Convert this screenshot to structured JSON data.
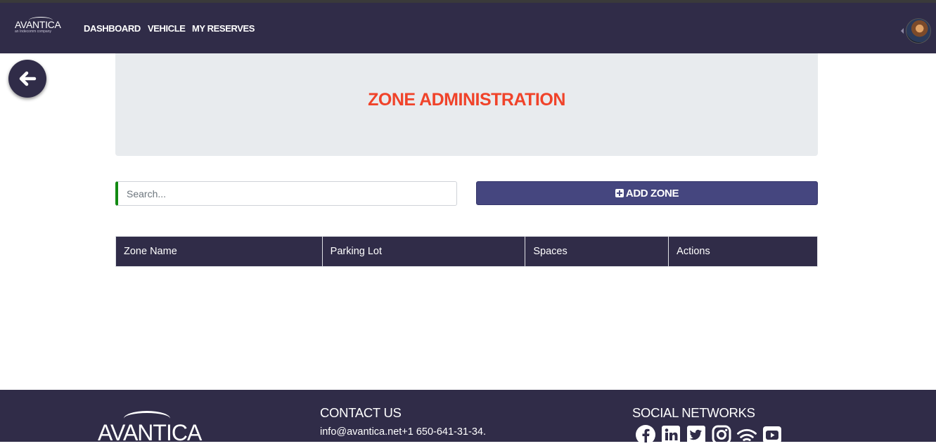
{
  "brand": {
    "name": "AVANTICA",
    "tagline": "an Indecomm company"
  },
  "nav": {
    "items": [
      "DASHBOARD",
      "VEHICLE",
      "MY RESERVES"
    ]
  },
  "page": {
    "title": "ZONE ADMINISTRATION"
  },
  "search": {
    "placeholder": "Search...",
    "value": ""
  },
  "actions": {
    "add_zone_label": "ADD ZONE"
  },
  "table": {
    "headers": [
      "Zone Name",
      "Parking Lot",
      "Spaces",
      "Actions"
    ],
    "rows": []
  },
  "footer": {
    "logo": "AVANTICA",
    "contact_heading": "CONTACT US",
    "contact_text": "info@avantica.net+1 650-641-31-34.",
    "social_heading": "SOCIAL NETWORKS",
    "social_icons": [
      "facebook-icon",
      "linkedin-icon",
      "twitter-icon",
      "instagram-icon",
      "rss-icon",
      "youtube-icon"
    ]
  },
  "colors": {
    "nav_bg": "#302c48",
    "accent_title": "#f0432a",
    "button_bg": "#45467f",
    "search_border": "#128a12"
  }
}
